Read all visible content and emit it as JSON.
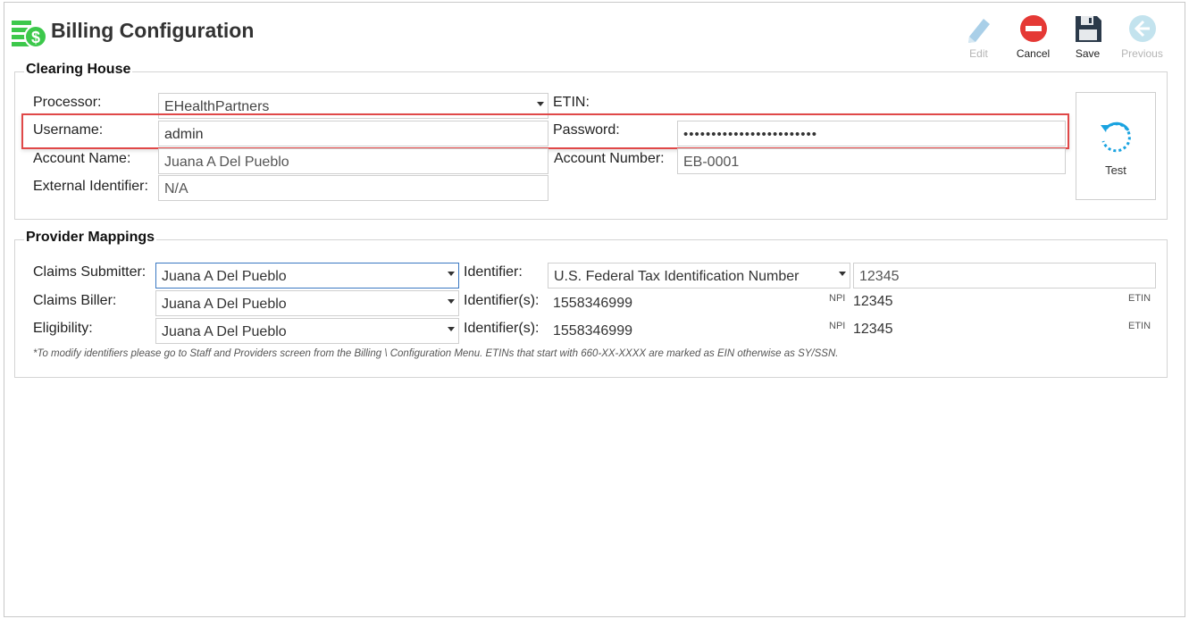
{
  "header": {
    "title": "Billing Configuration",
    "logo_icon": "money-stack-icon"
  },
  "toolbar": {
    "edit_label": "Edit",
    "cancel_label": "Cancel",
    "save_label": "Save",
    "previous_label": "Previous"
  },
  "clearing_house": {
    "title": "Clearing House",
    "processor_label": "Processor:",
    "processor_value": "EHealthPartners",
    "etin_label": "ETIN:",
    "username_label": "Username:",
    "username_value": "admin",
    "password_label": "Password:",
    "password_value": "••••••••••••••••••••••••",
    "account_name_label": "Account Name:",
    "account_name_value": "Juana A Del Pueblo",
    "account_number_label": "Account Number:",
    "account_number_value": "EB-0001",
    "external_identifier_label": "External Identifier:",
    "external_identifier_value": "N/A",
    "test_label": "Test"
  },
  "provider_mappings": {
    "title": "Provider Mappings",
    "claims_submitter_label": "Claims Submitter:",
    "claims_submitter_value": "Juana A Del Pueblo",
    "identifier_label": "Identifier:",
    "identifier_type_value": "U.S. Federal Tax Identification Number",
    "identifier_value": "12345",
    "claims_biller_label": "Claims Biller:",
    "claims_biller_value": "Juana A Del Pueblo",
    "biller_identifiers_label": "Identifier(s):",
    "biller_npi_value": "1558346999",
    "biller_npi_tag": "NPI",
    "biller_etin_value": "12345",
    "biller_etin_tag": "ETIN",
    "eligibility_label": "Eligibility:",
    "eligibility_value": "Juana A Del Pueblo",
    "eligibility_identifiers_label": "Identifier(s):",
    "eligibility_npi_value": "1558346999",
    "eligibility_npi_tag": "NPI",
    "eligibility_etin_value": "12345",
    "eligibility_etin_tag": "ETIN",
    "note": "*To modify identifiers please go to Staff and Providers screen from the Billing \\ Configuration Menu. ETINs that start with 660-XX-XXXX are marked as EIN otherwise as SY/SSN."
  },
  "colors": {
    "accent": "#3a78c2",
    "highlight": "#e04848",
    "cancel_red": "#e53935",
    "save_navy": "#2b3a4a",
    "test_blue": "#1aa3e0",
    "logo_green": "#3cc84b"
  }
}
